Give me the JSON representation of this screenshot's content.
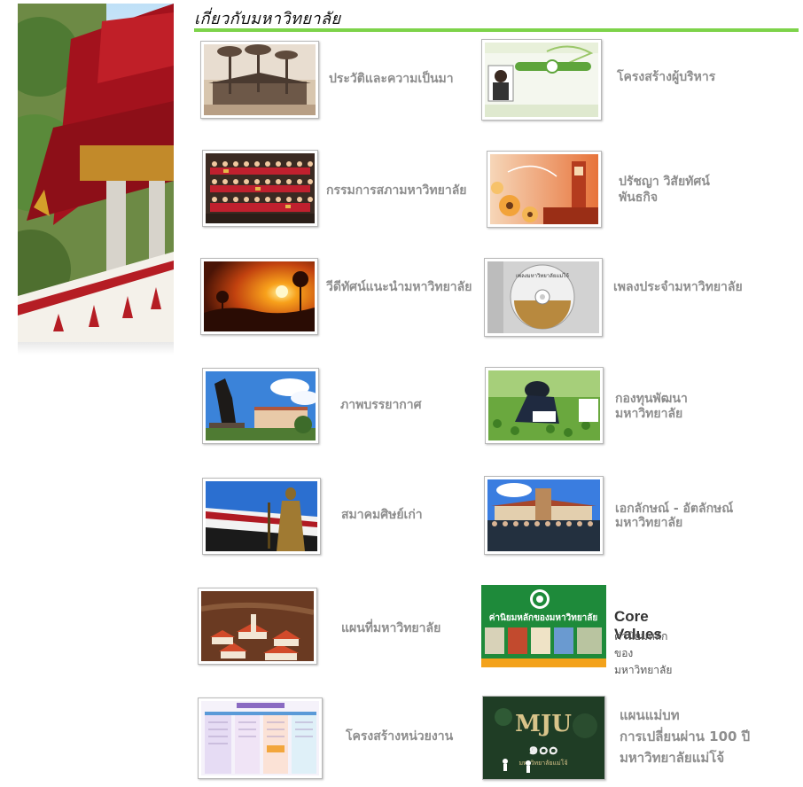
{
  "section": {
    "title": "เกี่ยวกับมหาวิทยาลัย"
  },
  "colors": {
    "accent_rule": "#7dd34a",
    "label_grey": "#8e8e8e",
    "core_green": "#1e8a3a",
    "core_orange": "#f3a21b"
  },
  "items": [
    {
      "label": "ประวัติและความเป็นมา",
      "icon": "historic-building-photo"
    },
    {
      "label": "โครงสร้างผู้บริหาร",
      "icon": "administrator-structure-webpage"
    },
    {
      "label": "กรรมการสภามหาวิทยาลัย",
      "icon": "council-group-photo"
    },
    {
      "label": "ปรัชญา วิสัยทัศน์",
      "label2": "พันธกิจ",
      "icon": "clock-tower-flowers"
    },
    {
      "label": "วีดีทัศน์แนะนำมหาวิทยาลัย",
      "icon": "sunset-video"
    },
    {
      "label": "เพลงประจำมหาวิทยาลัย",
      "icon": "music-cd",
      "cd_text": "เพลงมหาวิทยาลัยแม่โจ้"
    },
    {
      "label": "ภาพบรรยากาศ",
      "icon": "campus-statue-photo"
    },
    {
      "label": "กองทุนพัฒนา",
      "label2": "มหาวิทยาลัย",
      "icon": "farmer-writing-photo"
    },
    {
      "label": "สมาคมศิษย์เก่า",
      "icon": "alumni-statue-photo"
    },
    {
      "label": "เอกลักษณ์ - อัตลักษณ์",
      "label2": "มหาวิทยาลัย",
      "icon": "identity-group-photo"
    },
    {
      "label": "แผนที่มหาวิทยาลัย",
      "icon": "campus-map"
    },
    {
      "label": "Core Values",
      "label2": "ค่านิยมหลักของมหาวิทยาลัย",
      "icon": "core-values-banner",
      "banner_text": "ค่านิยมหลักของมหาวิทยาลัย"
    },
    {
      "label": "โครงสร้างหน่วยงาน",
      "icon": "organization-chart"
    },
    {
      "label": "แผนแม่บท",
      "label2": "การเปลี่ยนผ่าน 100 ปี",
      "label3": "มหาวิทยาลัยแม่โจ้",
      "icon": "mju-100-years-poster",
      "poster_logo": "MJU",
      "poster_sub": "มหาวิทยาลัยแม่โจ้",
      "poster_num": "๑๐๐"
    }
  ]
}
